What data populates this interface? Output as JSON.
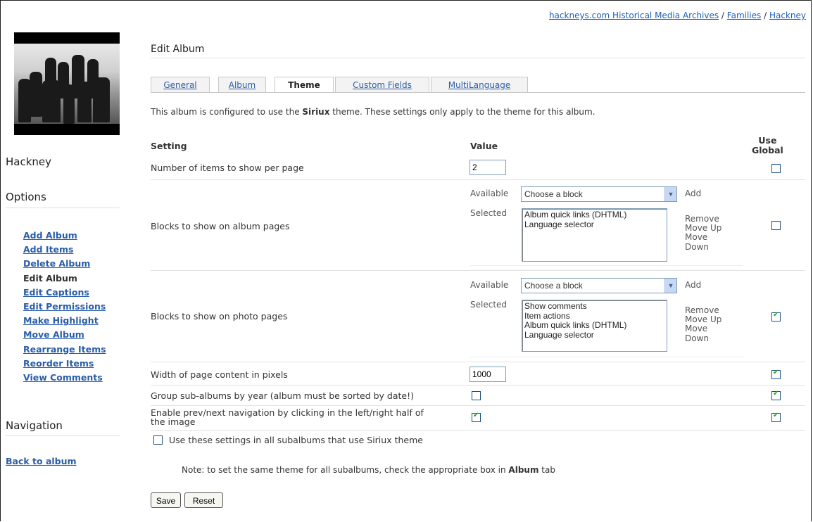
{
  "breadcrumb": {
    "items": [
      "hackneys.com Historical Media Archives",
      "Families",
      "Hackney"
    ],
    "separator": "/"
  },
  "sidebar": {
    "album_title": "Hackney",
    "options_title": "Options",
    "options": [
      {
        "label": "Add Album",
        "link": true
      },
      {
        "label": "Add Items",
        "link": true
      },
      {
        "label": "Delete Album",
        "link": true
      },
      {
        "label": "Edit Album",
        "link": false
      },
      {
        "label": "Edit Captions",
        "link": true
      },
      {
        "label": "Edit Permissions",
        "link": true
      },
      {
        "label": "Make Highlight",
        "link": true
      },
      {
        "label": "Move Album",
        "link": true
      },
      {
        "label": "Rearrange Items",
        "link": true
      },
      {
        "label": "Reorder Items",
        "link": true
      },
      {
        "label": "View Comments",
        "link": true
      }
    ],
    "navigation_title": "Navigation",
    "back_link": "Back to album"
  },
  "main": {
    "heading": "Edit Album",
    "tabs": [
      "General",
      "Album",
      "Theme",
      "Custom Fields",
      "MultiLanguage"
    ],
    "active_tab": "Theme",
    "intro_before": "This album is configured to use the ",
    "intro_theme": "Siriux",
    "intro_after": " theme. These settings only apply to the theme for this album.",
    "columns": {
      "setting": "Setting",
      "value": "Value",
      "use_global_1": "Use",
      "use_global_2": "Global"
    },
    "rows": {
      "items_per_page": {
        "label": "Number of items to show per page",
        "value": "2",
        "use_global": false
      },
      "album_blocks": {
        "label": "Blocks to show on album pages",
        "available_label": "Available",
        "select_value": "Choose a block",
        "add": "Add",
        "selected_label": "Selected",
        "selected": [
          "Album quick links (DHTML)",
          "Language selector"
        ],
        "remove": "Remove",
        "move_up": "Move Up",
        "move_down_1": "Move",
        "move_down_2": "Down",
        "use_global": false
      },
      "photo_blocks": {
        "label": "Blocks to show on photo pages",
        "available_label": "Available",
        "select_value": "Choose a block",
        "add": "Add",
        "selected_label": "Selected",
        "selected": [
          "Show comments",
          "Item actions",
          "Album quick links (DHTML)",
          "Language selector"
        ],
        "remove": "Remove",
        "move_up": "Move Up",
        "move_down_1": "Move",
        "move_down_2": "Down",
        "use_global": true
      },
      "page_width": {
        "label": "Width of page content in pixels",
        "value": "1000",
        "use_global": true
      },
      "group_by_year": {
        "label": "Group sub-albums by year (album must be sorted by date!)",
        "checked": false,
        "use_global": true
      },
      "prev_next": {
        "label_1": "Enable prev/next navigation by clicking in the left/right half of",
        "label_2": "the image",
        "checked": true,
        "use_global": true
      }
    },
    "subalbums_option": {
      "label": "Use these settings in all subalbums that use Siriux theme",
      "checked": false
    },
    "note_before": "Note: to set the same theme for all subalbums, check the appropriate box in ",
    "note_bold": "Album",
    "note_after": " tab",
    "save_button": "Save",
    "reset_button": "Reset"
  },
  "colors": {
    "link": "#2a5ea8",
    "check": "#21a121",
    "select_arrow": "#c7d8f5"
  }
}
